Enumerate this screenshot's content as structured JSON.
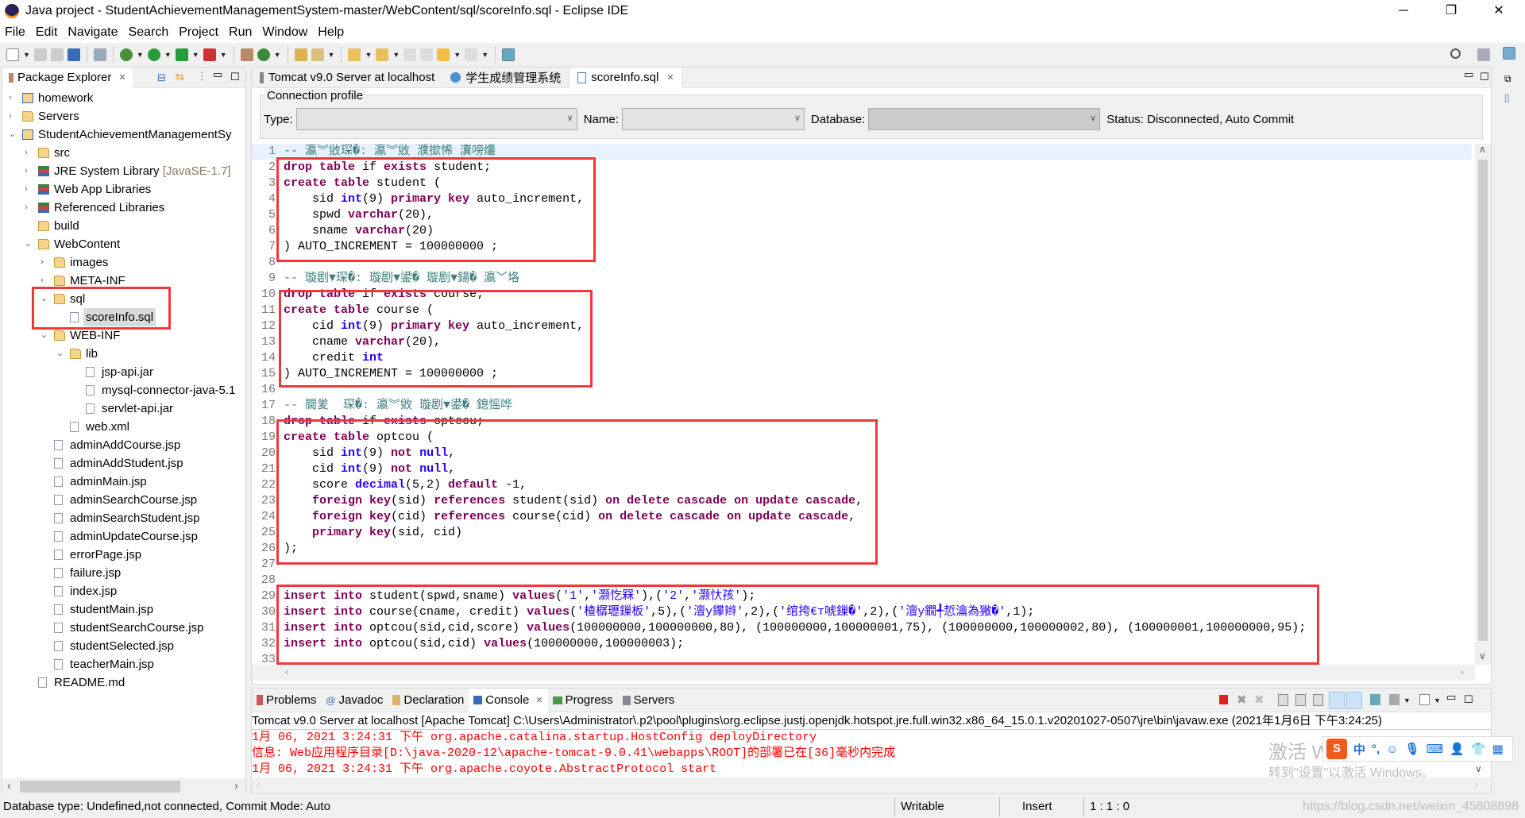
{
  "window": {
    "title": "Java project - StudentAchievementManagementSystem-master/WebContent/sql/scoreInfo.sql - Eclipse IDE",
    "minimize": "─",
    "restore": "❐",
    "close": "✕"
  },
  "menu": [
    "File",
    "Edit",
    "Navigate",
    "Search",
    "Project",
    "Run",
    "Window",
    "Help"
  ],
  "explorer": {
    "title": "Package Explorer",
    "items": [
      {
        "label": "homework",
        "level": 0,
        "chev": "›",
        "icon": "proj"
      },
      {
        "label": "Servers",
        "level": 0,
        "chev": "›",
        "icon": "folder"
      },
      {
        "label": "StudentAchievementManagementSy",
        "level": 0,
        "chev": "⌄",
        "icon": "proj"
      },
      {
        "label": "src",
        "level": 1,
        "chev": "›",
        "icon": "folder"
      },
      {
        "label": "JRE System Library",
        "decoration": "[JavaSE-1.7]",
        "level": 1,
        "chev": "›",
        "icon": "lib"
      },
      {
        "label": "Web App Libraries",
        "level": 1,
        "chev": "›",
        "icon": "lib"
      },
      {
        "label": "Referenced Libraries",
        "level": 1,
        "chev": "›",
        "icon": "lib"
      },
      {
        "label": "build",
        "level": 1,
        "chev": "",
        "icon": "folder"
      },
      {
        "label": "WebContent",
        "level": 1,
        "chev": "⌄",
        "icon": "folder"
      },
      {
        "label": "images",
        "level": 2,
        "chev": "›",
        "icon": "folder"
      },
      {
        "label": "META-INF",
        "level": 2,
        "chev": "›",
        "icon": "folder"
      },
      {
        "label": "sql",
        "level": 2,
        "chev": "⌄",
        "icon": "folder"
      },
      {
        "label": "scoreInfo.sql",
        "level": 3,
        "chev": "",
        "icon": "file",
        "selected": true
      },
      {
        "label": "WEB-INF",
        "level": 2,
        "chev": "⌄",
        "icon": "folder"
      },
      {
        "label": "lib",
        "level": 3,
        "chev": "⌄",
        "icon": "folder"
      },
      {
        "label": "jsp-api.jar",
        "level": 4,
        "chev": "",
        "icon": "file"
      },
      {
        "label": "mysql-connector-java-5.1",
        "level": 4,
        "chev": "",
        "icon": "file"
      },
      {
        "label": "servlet-api.jar",
        "level": 4,
        "chev": "",
        "icon": "file"
      },
      {
        "label": "web.xml",
        "level": 3,
        "chev": "",
        "icon": "file"
      },
      {
        "label": "adminAddCourse.jsp",
        "level": 2,
        "chev": "",
        "icon": "file"
      },
      {
        "label": "adminAddStudent.jsp",
        "level": 2,
        "chev": "",
        "icon": "file"
      },
      {
        "label": "adminMain.jsp",
        "level": 2,
        "chev": "",
        "icon": "file"
      },
      {
        "label": "adminSearchCourse.jsp",
        "level": 2,
        "chev": "",
        "icon": "file"
      },
      {
        "label": "adminSearchStudent.jsp",
        "level": 2,
        "chev": "",
        "icon": "file"
      },
      {
        "label": "adminUpdateCourse.jsp",
        "level": 2,
        "chev": "",
        "icon": "file"
      },
      {
        "label": "errorPage.jsp",
        "level": 2,
        "chev": "",
        "icon": "file"
      },
      {
        "label": "failure.jsp",
        "level": 2,
        "chev": "",
        "icon": "file"
      },
      {
        "label": "index.jsp",
        "level": 2,
        "chev": "",
        "icon": "file"
      },
      {
        "label": "studentMain.jsp",
        "level": 2,
        "chev": "",
        "icon": "file"
      },
      {
        "label": "studentSearchCourse.jsp",
        "level": 2,
        "chev": "",
        "icon": "file"
      },
      {
        "label": "studentSelected.jsp",
        "level": 2,
        "chev": "",
        "icon": "file"
      },
      {
        "label": "teacherMain.jsp",
        "level": 2,
        "chev": "",
        "icon": "file"
      },
      {
        "label": "README.md",
        "level": 1,
        "chev": "",
        "icon": "file"
      }
    ]
  },
  "editor": {
    "tabs": [
      {
        "label": "Tomcat v9.0 Server at localhost",
        "active": false
      },
      {
        "label": "学生成绩管理系统",
        "active": false
      },
      {
        "label": "scoreInfo.sql",
        "active": true
      }
    ],
    "connection": {
      "legend": "Connection profile",
      "type_label": "Type:",
      "type_value": "",
      "name_label": "Name:",
      "name_value": "",
      "database_label": "Database:",
      "database_value": "",
      "status": "Status: Disconnected, Auto Commit"
    },
    "lines": [
      [
        [
          "c",
          "-- 瀛︾敓琛�: 瀛︾敓 濮撳悕 瀵嗙爜"
        ]
      ],
      [
        [
          "k",
          "drop table "
        ],
        [
          "p",
          "if "
        ],
        [
          "k",
          "exists "
        ],
        [
          "p",
          "student;"
        ]
      ],
      [
        [
          "k",
          "create table "
        ],
        [
          "p",
          "student ("
        ]
      ],
      [
        [
          "p",
          "    sid "
        ],
        [
          "ty",
          "int"
        ],
        [
          "p",
          "(9) "
        ],
        [
          "k",
          "primary key "
        ],
        [
          "p",
          "auto_increment,"
        ]
      ],
      [
        [
          "p",
          "    spwd "
        ],
        [
          "k",
          "varchar"
        ],
        [
          "p",
          "(20),"
        ]
      ],
      [
        [
          "p",
          "    sname "
        ],
        [
          "k",
          "varchar"
        ],
        [
          "p",
          "(20)"
        ]
      ],
      [
        [
          "p",
          ") AUTO_INCREMENT = 100000000 ;"
        ]
      ],
      [],
      [
        [
          "c",
          "-- 璇剧▼琛�: 璇剧▼鍙� 璇剧▼鍚� 瀛﹀垎"
        ]
      ],
      [
        [
          "k",
          "drop table "
        ],
        [
          "p",
          "if "
        ],
        [
          "k",
          "exists "
        ],
        [
          "p",
          "course;"
        ]
      ],
      [
        [
          "k",
          "create table "
        ],
        [
          "p",
          "course ("
        ]
      ],
      [
        [
          "p",
          "    cid "
        ],
        [
          "ty",
          "int"
        ],
        [
          "p",
          "(9) "
        ],
        [
          "k",
          "primary key "
        ],
        [
          "p",
          "auto_increment,"
        ]
      ],
      [
        [
          "p",
          "    cname "
        ],
        [
          "k",
          "varchar"
        ],
        [
          "p",
          "(20),"
        ]
      ],
      [
        [
          "p",
          "    credit "
        ],
        [
          "ty",
          "int"
        ]
      ],
      [
        [
          "p",
          ") AUTO_INCREMENT = 100000000 ;"
        ]
      ],
      [],
      [
        [
          "c",
          "-- 閫夎  琛�: 瀛︾敓 璇剧▼鍙� 鎴愮哗"
        ]
      ],
      [
        [
          "k",
          "drop table "
        ],
        [
          "p",
          "if "
        ],
        [
          "k",
          "exists "
        ],
        [
          "p",
          "optcou;"
        ]
      ],
      [
        [
          "k",
          "create table "
        ],
        [
          "p",
          "optcou ("
        ]
      ],
      [
        [
          "p",
          "    sid "
        ],
        [
          "ty",
          "int"
        ],
        [
          "p",
          "(9) "
        ],
        [
          "k",
          "not "
        ],
        [
          "ty",
          "null"
        ],
        [
          "p",
          ","
        ]
      ],
      [
        [
          "p",
          "    cid "
        ],
        [
          "ty",
          "int"
        ],
        [
          "p",
          "(9) "
        ],
        [
          "k",
          "not "
        ],
        [
          "ty",
          "null"
        ],
        [
          "p",
          ","
        ]
      ],
      [
        [
          "p",
          "    score "
        ],
        [
          "ty",
          "decimal"
        ],
        [
          "p",
          "(5,2) "
        ],
        [
          "k",
          "default "
        ],
        [
          "p",
          "-1,"
        ]
      ],
      [
        [
          "p",
          "    "
        ],
        [
          "k",
          "foreign key"
        ],
        [
          "p",
          "(sid) "
        ],
        [
          "k",
          "references "
        ],
        [
          "p",
          "student(sid) "
        ],
        [
          "k",
          "on delete cascade on update cascade"
        ],
        [
          "p",
          ","
        ]
      ],
      [
        [
          "p",
          "    "
        ],
        [
          "k",
          "foreign key"
        ],
        [
          "p",
          "(cid) "
        ],
        [
          "k",
          "references "
        ],
        [
          "p",
          "course(cid) "
        ],
        [
          "k",
          "on delete cascade on update cascade"
        ],
        [
          "p",
          ","
        ]
      ],
      [
        [
          "p",
          "    "
        ],
        [
          "k",
          "primary key"
        ],
        [
          "p",
          "(sid, cid)"
        ]
      ],
      [
        [
          "p",
          ");"
        ]
      ],
      [],
      [],
      [
        [
          "k",
          "insert into "
        ],
        [
          "p",
          "student(spwd,sname) "
        ],
        [
          "k",
          "values"
        ],
        [
          "p",
          "("
        ],
        [
          "s",
          "'1'"
        ],
        [
          "p",
          ","
        ],
        [
          "s",
          "'灏忔槑'"
        ],
        [
          "p",
          "),("
        ],
        [
          "s",
          "'2'"
        ],
        [
          "p",
          ","
        ],
        [
          "s",
          "'灏忕孩'"
        ],
        [
          "p",
          ");"
        ]
      ],
      [
        [
          "k",
          "insert into "
        ],
        [
          "p",
          "course(cname, credit) "
        ],
        [
          "k",
          "values"
        ],
        [
          "p",
          "("
        ],
        [
          "s",
          "'楂樼瓑鏁板'"
        ],
        [
          "p",
          ",5),("
        ],
        [
          "s",
          "'澶у鑻辫'"
        ],
        [
          "p",
          ",2),("
        ],
        [
          "s",
          "'绾挎€т唬鏁�'"
        ],
        [
          "p",
          ",2),("
        ],
        [
          "s",
          "'澶у鐗╃悊瀹為獙�'"
        ],
        [
          "p",
          ",1);"
        ]
      ],
      [
        [
          "k",
          "insert into "
        ],
        [
          "p",
          "optcou(sid,cid,score) "
        ],
        [
          "k",
          "values"
        ],
        [
          "p",
          "(100000000,100000000,80), (100000000,100000001,75), (100000000,100000002,80), (100000001,100000000,95);"
        ]
      ],
      [
        [
          "k",
          "insert into "
        ],
        [
          "p",
          "optcou(sid,cid) "
        ],
        [
          "k",
          "values"
        ],
        [
          "p",
          "(100000000,100000003);"
        ]
      ],
      []
    ]
  },
  "console": {
    "tabs": [
      {
        "label": "Problems",
        "active": false
      },
      {
        "label": "Javadoc",
        "active": false
      },
      {
        "label": "Declaration",
        "active": false
      },
      {
        "label": "Console",
        "active": true
      },
      {
        "label": "Progress",
        "active": false
      },
      {
        "label": "Servers",
        "active": false
      }
    ],
    "header": "Tomcat v9.0 Server at localhost [Apache Tomcat] C:\\Users\\Administrator\\.p2\\pool\\plugins\\org.eclipse.justj.openjdk.hotspot.jre.full.win32.x86_64_15.0.1.v20201027-0507\\jre\\bin\\javaw.exe  (2021年1月6日 下午3:24:25)",
    "lines": [
      "1月 06, 2021 3:24:31 下午 org.apache.catalina.startup.HostConfig deployDirectory",
      "信息: Web应用程序目录[D:\\java-2020-12\\apache-tomcat-9.0.41\\webapps\\ROOT]的部署已在[36]毫秒内完成",
      "1月 06, 2021 3:24:31 下午 org.apache.coyote.AbstractProtocol start"
    ]
  },
  "statusbar": {
    "left": "Database type: Undefined,not connected, Commit Mode: Auto",
    "writable": "Writable",
    "insert": "Insert",
    "position": "1 : 1 : 0"
  },
  "watermark": {
    "activate_title": "激活 Windows",
    "activate_sub": "转到\"设置\"以激活 Windows。",
    "blog": "https://blog.csdn.net/weixin_45808898"
  },
  "colors": {
    "keyword": "#7f0055",
    "type": "#2a00ff",
    "string": "#2a00ff",
    "comment": "#3f7f7f",
    "console_error": "#ff0000",
    "annotation_box": "#f0383c"
  }
}
